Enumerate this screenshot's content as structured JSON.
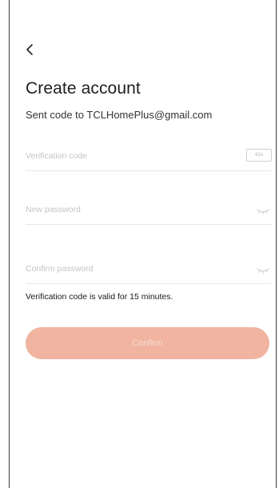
{
  "page": {
    "title": "Create account",
    "subtitle": "Sent code to TCLHomePlus@gmail.com"
  },
  "fields": {
    "verification_code": {
      "placeholder": "Verification code",
      "value": "",
      "timer": "42s"
    },
    "new_password": {
      "placeholder": "New password",
      "value": ""
    },
    "confirm_password": {
      "placeholder": "Confirm password",
      "value": ""
    }
  },
  "hint": "Verification code is valid for 15 minutes.",
  "buttons": {
    "confirm_label": "Confirm"
  },
  "colors": {
    "button_bg": "#f0b4a0",
    "button_text": "#f7dcd2",
    "divider": "#e6e6e6",
    "placeholder": "#c4c4c4"
  },
  "icons": {
    "back": "chevron-left-icon",
    "password_toggle": "eye-closed-icon"
  }
}
